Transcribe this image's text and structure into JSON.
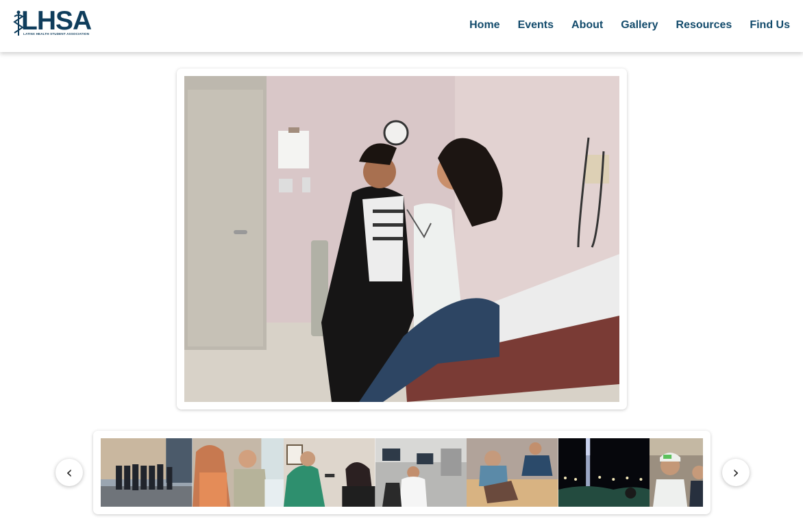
{
  "header": {
    "logo_text": "LHSA",
    "logo_tagline": "LATINX HEALTH STUDENT ASSOCIATION",
    "nav": [
      "Home",
      "Events",
      "About",
      "Gallery",
      "Resources",
      "Find Us"
    ]
  },
  "gallery": {
    "main_photo_icon": "exam-room-photo",
    "thumbnails": [
      "group-outside-building-photo",
      "patient-exam-photo",
      "vision-check-photo",
      "computer-lab-photo",
      "craft-table-photo",
      "night-festival-photo",
      "hardhat-selfie-photo"
    ],
    "prev_glyph": "‹",
    "next_glyph": "›"
  },
  "colors": {
    "brand": "#0f3d5c",
    "nav_text": "#124a6b"
  }
}
